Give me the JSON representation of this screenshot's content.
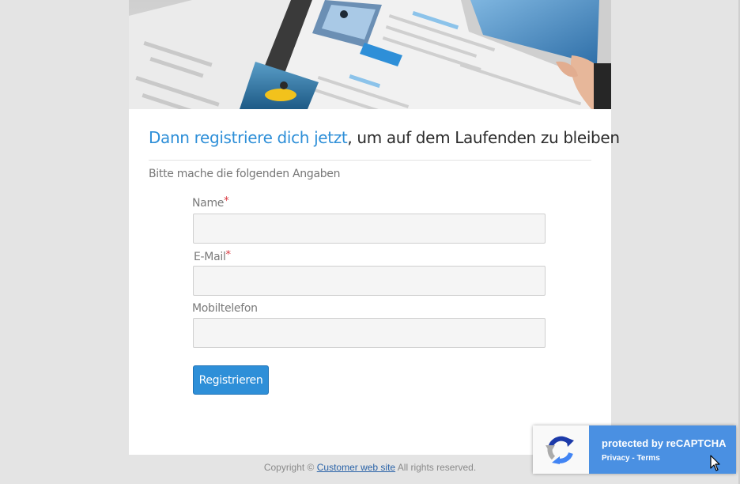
{
  "headline": {
    "accent": "Dann registriere dich jetzt",
    "rest": ", um auf dem Laufenden zu bleiben"
  },
  "intro": "Bitte mache die folgenden Angaben",
  "form": {
    "fields": [
      {
        "label": "Name",
        "required": true,
        "value": ""
      },
      {
        "label": "E-Mail",
        "required": true,
        "value": ""
      },
      {
        "label": "Mobiltelefon",
        "required": false,
        "value": ""
      }
    ],
    "required_marker": "*",
    "submit_label": "Registrieren"
  },
  "footer": {
    "prefix": "Copyright ©",
    "link": "Customer web site",
    "suffix": "All rights reserved."
  },
  "recaptcha": {
    "title": "protected by reCAPTCHA",
    "privacy": "Privacy",
    "separator": " - ",
    "terms": "Terms"
  },
  "colors": {
    "accent": "#2e8fd8",
    "page_background": "#e4e4e4",
    "recaptcha_blue": "#4a90e2",
    "required": "#d9363e"
  }
}
